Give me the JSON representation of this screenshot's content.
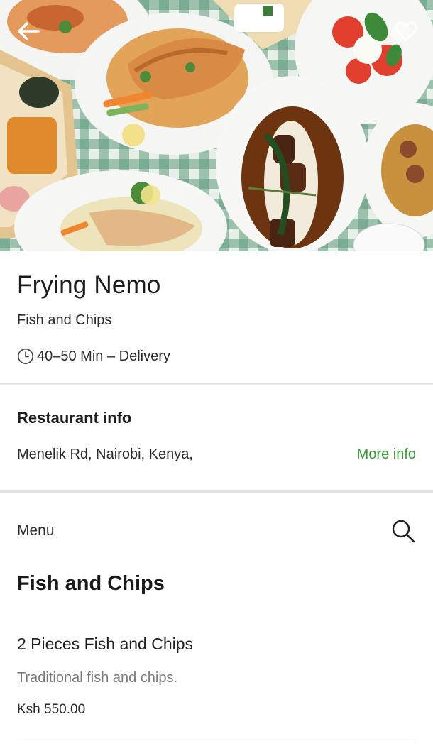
{
  "icons": {
    "back": "arrow-left-icon",
    "favorite": "heart-outline-icon",
    "clock": "clock-icon",
    "search": "search-icon"
  },
  "colors": {
    "accent": "#3a9a3a",
    "divider": "#e4e4e4",
    "muted_text": "#7a7a7a"
  },
  "restaurant": {
    "name": "Frying Nemo",
    "cuisine": "Fish and Chips",
    "eta": "40–50 Min – Delivery"
  },
  "restaurant_info": {
    "heading": "Restaurant info",
    "address": "Menelik Rd, Nairobi, Kenya,",
    "more_info_label": "More info"
  },
  "menu": {
    "label": "Menu",
    "sections": [
      {
        "title": "Fish and Chips",
        "items": [
          {
            "name": "2 Pieces Fish and Chips",
            "description": "Traditional fish and chips.",
            "price": "Ksh 550.00"
          }
        ]
      }
    ]
  }
}
